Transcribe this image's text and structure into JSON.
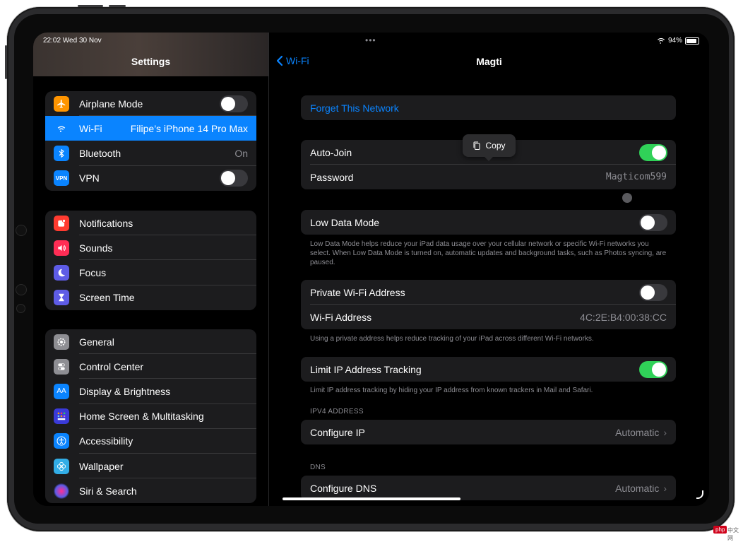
{
  "status": {
    "time": "22:02  Wed 30 Nov",
    "dots": "•••",
    "battery": "94%"
  },
  "sidebar": {
    "title": "Settings",
    "group1": [
      {
        "label": "Airplane Mode",
        "icon": "airplane-icon",
        "color": "#ff9500",
        "toggle": false
      },
      {
        "label": "Wi-Fi",
        "icon": "wifi-icon",
        "color": "#0a84ff",
        "value": "Filipe’s iPhone 14 Pro Max",
        "selected": true
      },
      {
        "label": "Bluetooth",
        "icon": "bluetooth-icon",
        "color": "#0a84ff",
        "value": "On"
      },
      {
        "label": "VPN",
        "icon": "vpn-icon",
        "color": "#0a84ff",
        "icon_text": "VPN",
        "toggle": false
      }
    ],
    "group2": [
      {
        "label": "Notifications",
        "icon": "bell-icon",
        "color": "#ff3b30"
      },
      {
        "label": "Sounds",
        "icon": "speaker-icon",
        "color": "#ff2d55"
      },
      {
        "label": "Focus",
        "icon": "moon-icon",
        "color": "#5e5ce6"
      },
      {
        "label": "Screen Time",
        "icon": "hourglass-icon",
        "color": "#5e5ce6"
      }
    ],
    "group3": [
      {
        "label": "General",
        "icon": "gear-icon",
        "color": "#8e8e93"
      },
      {
        "label": "Control Center",
        "icon": "switches-icon",
        "color": "#8e8e93"
      },
      {
        "label": "Display & Brightness",
        "icon": "text-size-icon",
        "color": "#0a84ff",
        "icon_text": "AA"
      },
      {
        "label": "Home Screen & Multitasking",
        "icon": "grid-icon",
        "color": "#3a3ad8"
      },
      {
        "label": "Accessibility",
        "icon": "accessibility-icon",
        "color": "#0a84ff"
      },
      {
        "label": "Wallpaper",
        "icon": "flower-icon",
        "color": "#32ade6"
      },
      {
        "label": "Siri & Search",
        "icon": "siri-icon",
        "color": "#1c1c1e"
      }
    ]
  },
  "detail": {
    "back_label": "Wi-Fi",
    "title": "Magti",
    "forget": "Forget This Network",
    "copy_label": "Copy",
    "auto_join": {
      "label": "Auto-Join",
      "toggle": true
    },
    "password": {
      "label": "Password",
      "value": "Magticom599"
    },
    "low_data": {
      "label": "Low Data Mode",
      "toggle": false
    },
    "low_data_note": "Low Data Mode helps reduce your iPad data usage over your cellular network or specific Wi-Fi networks you select. When Low Data Mode is turned on, automatic updates and background tasks, such as Photos syncing, are paused.",
    "private_addr": {
      "label": "Private Wi-Fi Address",
      "toggle": false
    },
    "wifi_addr": {
      "label": "Wi-Fi Address",
      "value": "4C:2E:B4:00:38:CC"
    },
    "private_note": "Using a private address helps reduce tracking of your iPad across different Wi-Fi networks.",
    "limit_ip": {
      "label": "Limit IP Address Tracking",
      "toggle": true
    },
    "limit_note": "Limit IP address tracking by hiding your IP address from known trackers in Mail and Safari.",
    "ipv4_header": "IPV4 ADDRESS",
    "configure_ip": {
      "label": "Configure IP",
      "value": "Automatic"
    },
    "dns_header": "DNS",
    "configure_dns": {
      "label": "Configure DNS",
      "value": "Automatic"
    }
  },
  "watermark": "php",
  "watermark_sub": "中文网"
}
